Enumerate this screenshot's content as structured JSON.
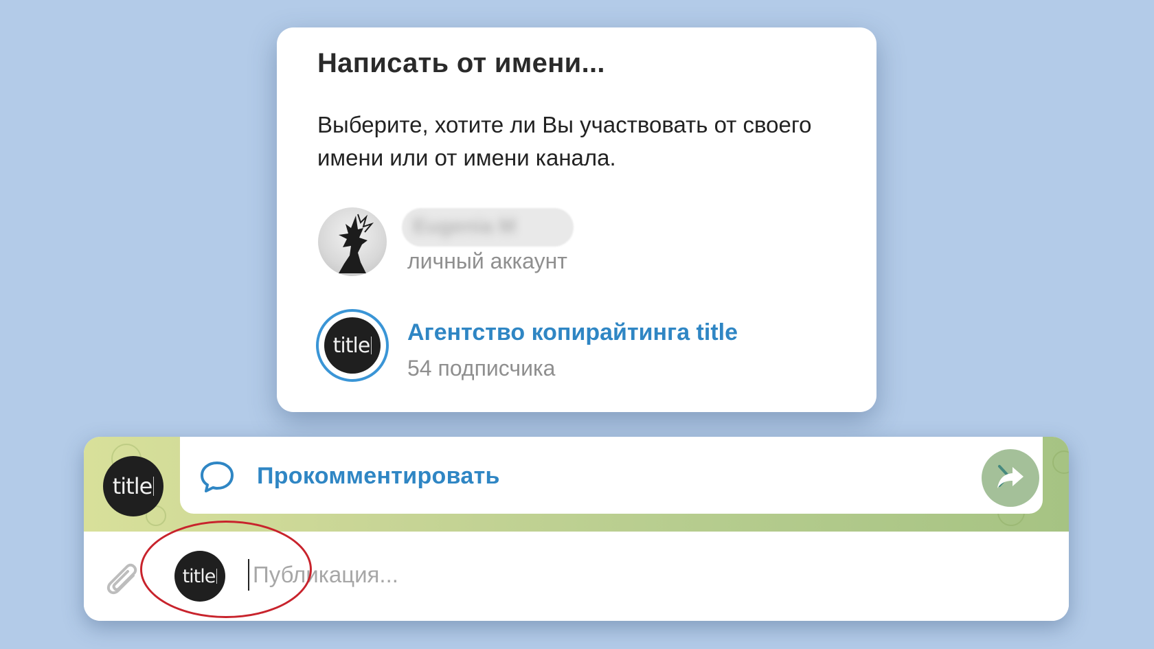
{
  "dialog": {
    "title": "Написать от имени...",
    "description": "Выберите, хотите ли Вы участвовать от своего имени или от имени канала.",
    "options": [
      {
        "name": "Eugenia M",
        "subtitle": "личный аккаунт",
        "selected": false,
        "avatar_icon": "profile-photo"
      },
      {
        "name": "Агентство копирайтинга title",
        "subtitle": "54 подписчика",
        "selected": true,
        "avatar_icon": "title-logo"
      }
    ]
  },
  "chat": {
    "channel_logo_text": "title",
    "comment_label": "Прокомментировать",
    "input_placeholder": "Публикация...",
    "icons": {
      "comment": "speech-bubble-icon",
      "chevron": "chevron-right-icon",
      "share": "share-arrow-icon",
      "attach": "paperclip-icon"
    }
  },
  "colors": {
    "background": "#b3cbe8",
    "link_blue": "#2f86c4",
    "highlight_red": "#c8232c",
    "logo_dark": "#1f1f1f"
  }
}
